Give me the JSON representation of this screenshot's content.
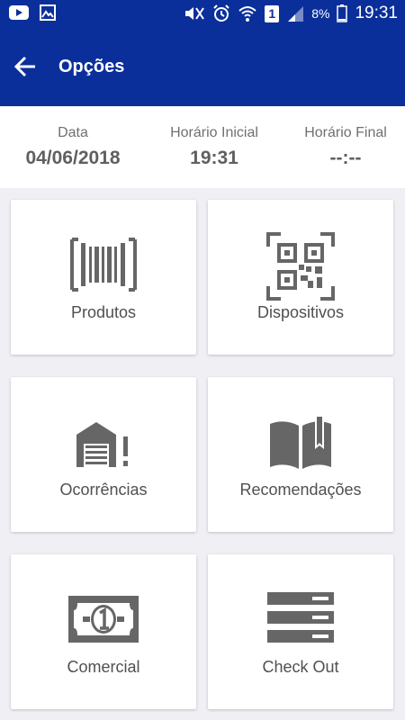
{
  "status_bar": {
    "battery": "8%",
    "time": "19:31",
    "sim": "1"
  },
  "app_bar": {
    "title": "Opções"
  },
  "info": {
    "date_label": "Data",
    "date_value": "04/06/2018",
    "start_label": "Horário Inicial",
    "start_value": "19:31",
    "end_label": "Horário Final",
    "end_value": "--:--"
  },
  "tiles": [
    {
      "label": "Produtos",
      "icon": "barcode-icon"
    },
    {
      "label": "Dispositivos",
      "icon": "qr-code-icon"
    },
    {
      "label": "Ocorrências",
      "icon": "warehouse-alert-icon"
    },
    {
      "label": "Recomendações",
      "icon": "open-book-icon"
    },
    {
      "label": "Comercial",
      "icon": "banknote-icon"
    },
    {
      "label": "Check Out",
      "icon": "list-icon"
    }
  ]
}
